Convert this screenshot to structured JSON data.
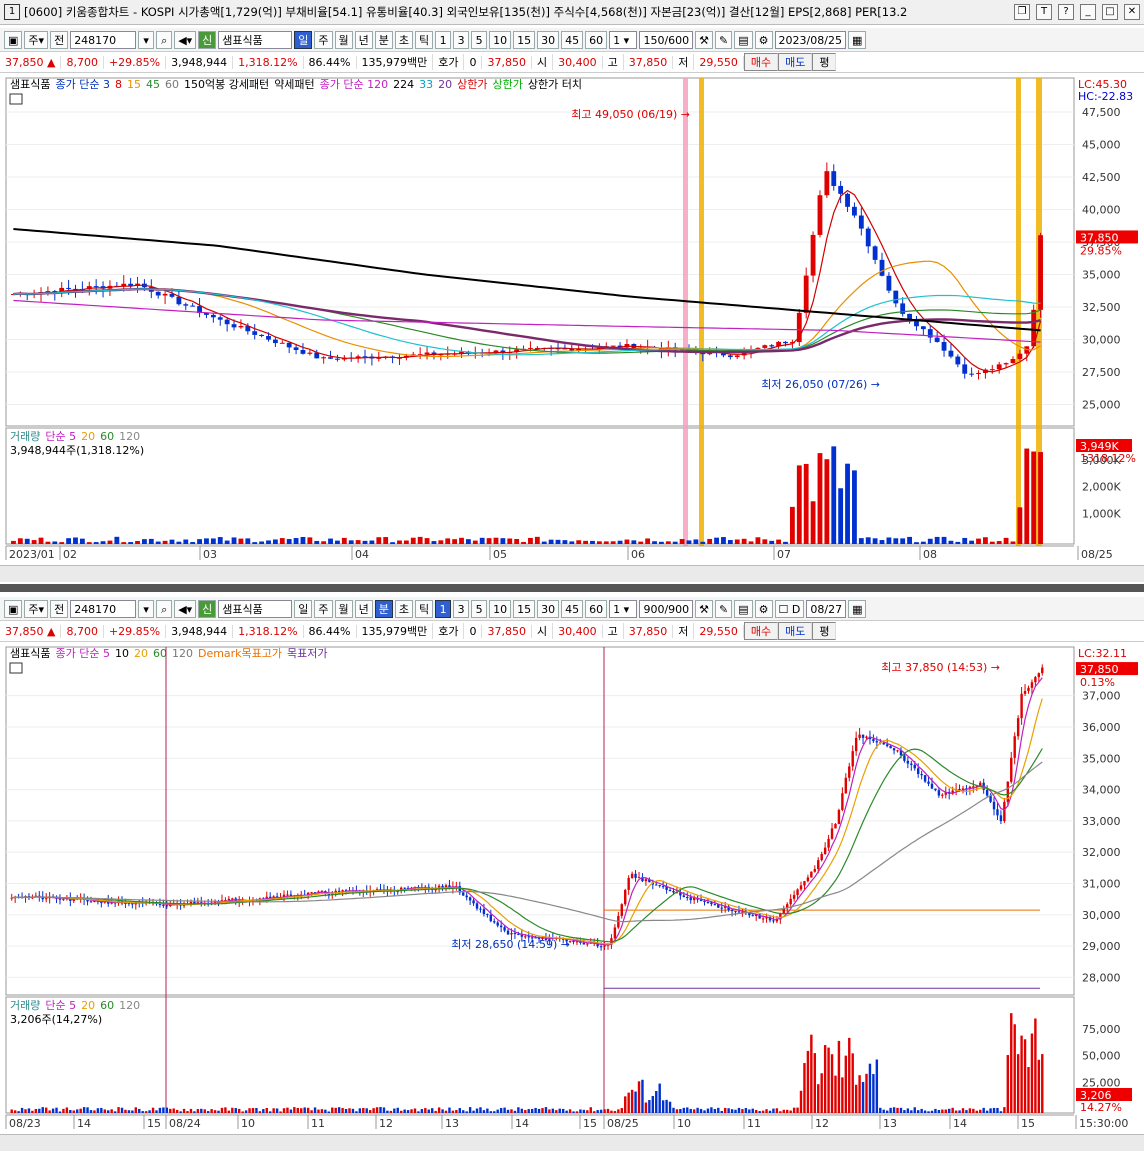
{
  "title": "[0600] 키움종합차트 - KOSPI 시가총액[1,729(억)] 부채비율[54.1] 유통비율[40.3] 외국인보유[135(천)] 주식수[4,568(천)] 자본금[23(억)] 결산[12월] EPS[2,868] PER[13.2",
  "window_num": "1",
  "colors": {
    "up": "#e00000",
    "down": "#0030d0",
    "ma5": "#d00000",
    "ma20": "#e89000",
    "ma60": "#2a8a2a",
    "ma120": "#7a2a6a",
    "ma224": "#000000",
    "vol": "#7030a0"
  },
  "top": {
    "toolbar": {
      "type": "주",
      "prev": "전",
      "code": "248170",
      "name": "샘표식품",
      "periods": [
        "일",
        "주",
        "월",
        "년",
        "분",
        "초",
        "틱"
      ],
      "active_period": "일",
      "nums": [
        "1",
        "3",
        "5",
        "10",
        "15",
        "30",
        "45",
        "60"
      ],
      "sel": "1",
      "count": "150/600",
      "date": "2023/08/25"
    },
    "quote": {
      "price": "37,850",
      "change": "8,700",
      "rate": "+29.85%",
      "volume": "3,948,944",
      "vol_rate": "1,318.12%",
      "ratio": "86.44%",
      "amount": "135,979백만",
      "hoga_label": "호가",
      "hoga_val": "0",
      "cur": "37,850",
      "open_l": "시",
      "open": "30,400",
      "high_l": "고",
      "high": "37,850",
      "low_l": "저",
      "low": "29,550",
      "buy": "매수",
      "sell": "매도",
      "flat": "평"
    },
    "legend": [
      "샘표식품",
      "종가 단순 3",
      "8",
      "15",
      "45",
      "60",
      "150억봉 강세패턴",
      "약세패턴",
      "종가 단순 120",
      "224",
      "33",
      "20",
      "상한가",
      "상한가",
      "상한가 터치"
    ],
    "yticks": [
      "47,500",
      "45,000",
      "42,500",
      "40,000",
      "37,500",
      "35,000",
      "32,500",
      "30,000",
      "27,500",
      "25,000"
    ],
    "lc": "LC:45.30",
    "hc": "HC:-22.83",
    "cur_label": "37,850",
    "cur_pct": "29.85%",
    "high_ann": "최고 49,050 (06/19)",
    "low_ann": "최저 26,050 (07/26)",
    "vol_legend": [
      "거래량",
      "단순 5",
      "20",
      "60",
      "120"
    ],
    "vol_text": "3,948,944주(1,318.12%)",
    "vol_yticks": [
      "3,000K",
      "2,000K",
      "1,000K"
    ],
    "vol_cur": "3,949K",
    "vol_pct": "1318.12%",
    "xticks": [
      "2023/01",
      "02",
      "03",
      "04",
      "05",
      "06",
      "07",
      "08",
      "08/25"
    ]
  },
  "bottom": {
    "toolbar": {
      "type": "주",
      "prev": "전",
      "code": "248170",
      "name": "샘표식품",
      "periods": [
        "일",
        "주",
        "월",
        "년",
        "분",
        "초",
        "틱"
      ],
      "active_period": "분",
      "nums": [
        "1",
        "3",
        "5",
        "10",
        "15",
        "30",
        "45",
        "60"
      ],
      "sel": "1",
      "count": "900/900",
      "date": "08/27",
      "d_label": "D"
    },
    "quote": {
      "price": "37,850",
      "change": "8,700",
      "rate": "+29.85%",
      "volume": "3,948,944",
      "vol_rate": "1,318.12%",
      "ratio": "86.44%",
      "amount": "135,979백만",
      "hoga_label": "호가",
      "hoga_val": "0",
      "cur": "37,850",
      "open_l": "시",
      "open": "30,400",
      "high_l": "고",
      "high": "37,850",
      "low_l": "저",
      "low": "29,550",
      "buy": "매수",
      "sell": "매도",
      "flat": "평"
    },
    "legend": [
      "샘표식품",
      "종가 단순 5",
      "10",
      "20",
      "60",
      "120",
      "Demark목표고가",
      "목표저가"
    ],
    "yticks": [
      "37,000",
      "36,000",
      "35,000",
      "34,000",
      "33,000",
      "32,000",
      "31,000",
      "30,000",
      "29,000",
      "28,000"
    ],
    "lc": "LC:32.11",
    "cur_label": "37,850",
    "cur_pct": "0.13%",
    "high_ann": "최고 37,850 (14:53)",
    "low_ann": "최저 28,650 (14:59)",
    "vol_legend": [
      "거래량",
      "단순 5",
      "20",
      "60",
      "120"
    ],
    "vol_text": "3,206주(14,27%)",
    "vol_yticks": [
      "75,000",
      "50,000",
      "25,000"
    ],
    "vol_cur": "3,206",
    "vol_pct": "14.27%",
    "xticks": [
      "08/23",
      "14",
      "15",
      "08/24",
      "10",
      "11",
      "12",
      "13",
      "14",
      "15",
      "08/25",
      "10",
      "11",
      "12",
      "13",
      "14",
      "15",
      "15:30:00"
    ]
  },
  "chart_data": [
    {
      "type": "line",
      "title": "샘표식품 일봉",
      "x": [
        "2023/01",
        "02",
        "03",
        "04",
        "05",
        "06",
        "06/19",
        "07",
        "07/26",
        "08",
        "08/25"
      ],
      "series": [
        {
          "name": "종가",
          "values": [
            33500,
            33800,
            28000,
            28500,
            29500,
            28500,
            49050,
            34000,
            26050,
            27800,
            37850
          ]
        },
        {
          "name": "224",
          "values": [
            38500,
            37000,
            35500,
            34300,
            33300,
            32500,
            32200,
            31800,
            31300,
            30900,
            30700
          ]
        }
      ],
      "ylim": [
        24000,
        50000
      ]
    },
    {
      "type": "line",
      "title": "샘표식품 1분봉",
      "x": [
        "08/23",
        "08/24",
        "08/25",
        "10",
        "11",
        "12",
        "13",
        "14",
        "15"
      ],
      "series": [
        {
          "name": "종가",
          "values": [
            30500,
            30300,
            30800,
            30700,
            30000,
            35800,
            34200,
            33500,
            37850
          ]
        }
      ],
      "ylim": [
        27500,
        38000
      ]
    }
  ]
}
